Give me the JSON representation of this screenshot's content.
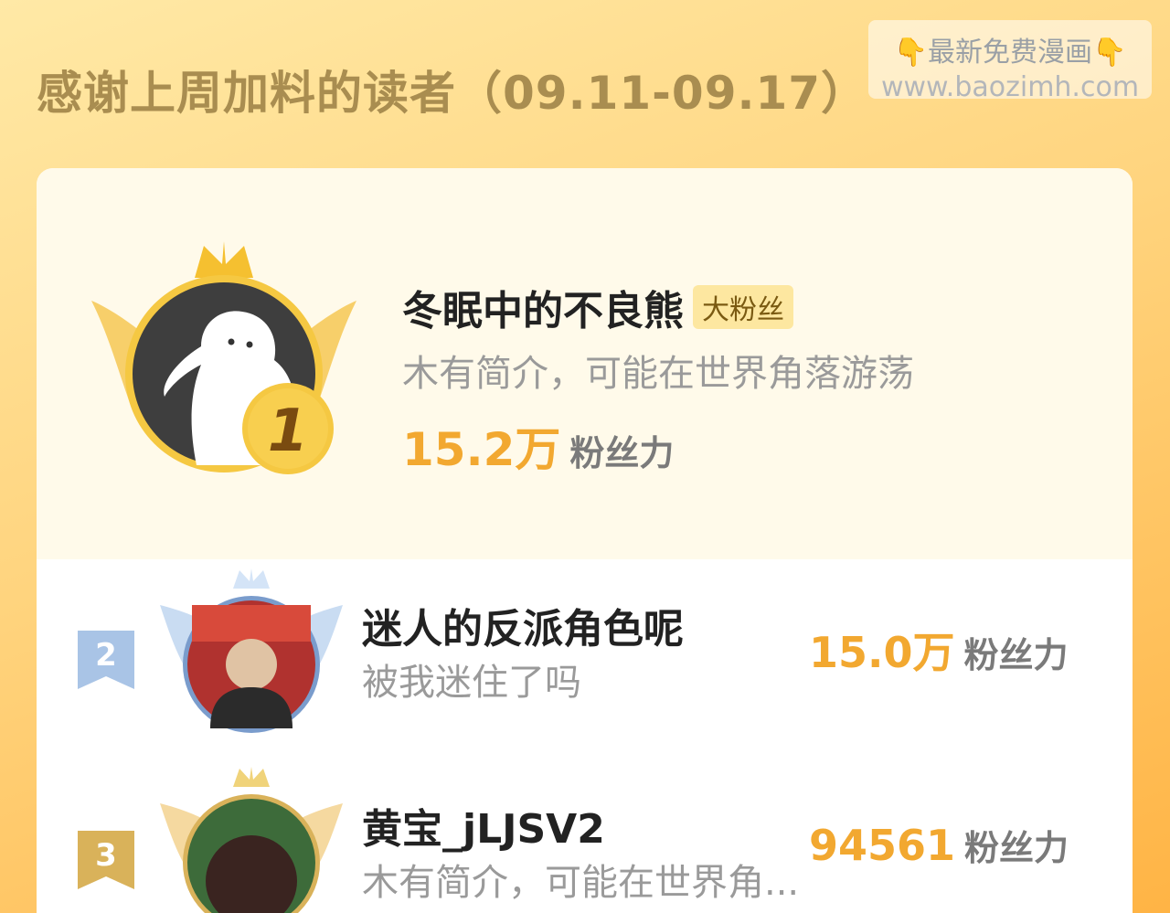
{
  "header": {
    "title": "感谢上周加料的读者（09.11-09.17）"
  },
  "watermark": {
    "line1": "最新免费漫画",
    "line2": "www.baozimh.com"
  },
  "leaderboard": {
    "first": {
      "rank": "1",
      "name": "冬眠中的不良熊",
      "badge": "大粉丝",
      "bio": "木有简介，可能在世界角落游荡",
      "score": "15.2万",
      "score_unit": "粉丝力"
    },
    "rows": [
      {
        "rank": "2",
        "name": "迷人的反派角色呢",
        "bio": "被我迷住了吗",
        "score": "15.0万",
        "score_unit": "粉丝力"
      },
      {
        "rank": "3",
        "name": "黄宝_jLJSV2",
        "bio": "木有简介，可能在世界角...",
        "score": "94561",
        "score_unit": "粉丝力"
      }
    ]
  },
  "colors": {
    "accent": "#f2a830",
    "gold": "#f5c842",
    "silver": "#a9c4e6",
    "bronze": "#d9b25a"
  }
}
